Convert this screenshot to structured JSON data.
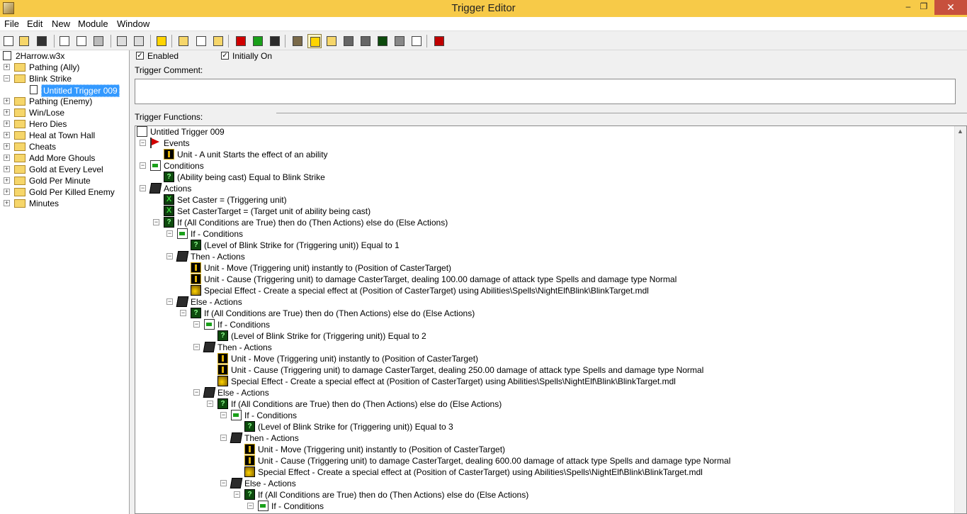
{
  "window": {
    "title": "Trigger Editor",
    "controls": {
      "minimize": "–",
      "restore": "❐",
      "close": "✕"
    }
  },
  "menu": [
    "File",
    "Edit",
    "New",
    "Module",
    "Window"
  ],
  "toolbar_icons": [
    "new-icon",
    "open-icon",
    "save-icon",
    "cut-icon",
    "copy-icon",
    "paste-icon",
    "undo-icon",
    "redo-icon",
    "delete-icon",
    "new-category-icon",
    "new-trigger-icon",
    "new-comment-icon",
    "new-event-icon",
    "new-condition-icon",
    "new-action-icon",
    "terrain-editor-icon",
    "trigger-editor-icon",
    "sound-editor-icon",
    "object-editor-icon",
    "campaign-editor-icon",
    "ai-editor-icon",
    "object-manager-icon",
    "import-manager-icon",
    "test-map-icon"
  ],
  "tree": {
    "root": "2Harrow.w3x",
    "categories": [
      {
        "label": "Pathing (Ally)",
        "expanded": false
      },
      {
        "label": "Blink Strike",
        "expanded": true,
        "children": [
          "Untitled Trigger 009"
        ]
      },
      {
        "label": "Pathing (Enemy)",
        "expanded": false
      },
      {
        "label": "Win/Lose",
        "expanded": false
      },
      {
        "label": "Hero Dies",
        "expanded": false
      },
      {
        "label": "Heal at Town Hall",
        "expanded": false
      },
      {
        "label": "Cheats",
        "expanded": false
      },
      {
        "label": "Add More Ghouls",
        "expanded": false
      },
      {
        "label": "Gold at Every Level",
        "expanded": false
      },
      {
        "label": "Gold Per Minute",
        "expanded": false
      },
      {
        "label": "Gold Per Killed Enemy",
        "expanded": false
      },
      {
        "label": "Minutes",
        "expanded": false
      }
    ],
    "selected": "Untitled Trigger 009"
  },
  "options": {
    "enabled_label": "Enabled",
    "enabled": true,
    "initially_on_label": "Initially On",
    "initially_on": true
  },
  "comment": {
    "label": "Trigger Comment:",
    "value": ""
  },
  "functions": {
    "label": "Trigger Functions:",
    "lines": [
      {
        "lvl": 0,
        "icon": "doc",
        "exp": "",
        "text": "Untitled Trigger 009"
      },
      {
        "lvl": 1,
        "icon": "evt",
        "exp": "−",
        "text": "Events"
      },
      {
        "lvl": 2,
        "icon": "unit",
        "exp": "",
        "text": "Unit - A unit Starts the effect of an ability"
      },
      {
        "lvl": 1,
        "icon": "cnd",
        "exp": "−",
        "text": "Conditions"
      },
      {
        "lvl": 2,
        "icon": "q",
        "exp": "",
        "text": "(Ability being cast) Equal to Blink Strike"
      },
      {
        "lvl": 1,
        "icon": "act",
        "exp": "−",
        "text": "Actions"
      },
      {
        "lvl": 2,
        "icon": "var",
        "exp": "",
        "text": "Set Caster = (Triggering unit)"
      },
      {
        "lvl": 2,
        "icon": "var",
        "exp": "",
        "text": "Set CasterTarget = (Target unit of ability being cast)"
      },
      {
        "lvl": 2,
        "icon": "q",
        "exp": "−",
        "text": "If (All Conditions are True) then do (Then Actions) else do (Else Actions)"
      },
      {
        "lvl": 3,
        "icon": "cnd",
        "exp": "−",
        "text": "If - Conditions"
      },
      {
        "lvl": 4,
        "icon": "q",
        "exp": "",
        "text": "(Level of Blink Strike  for (Triggering unit)) Equal to 1"
      },
      {
        "lvl": 3,
        "icon": "act",
        "exp": "−",
        "text": "Then - Actions"
      },
      {
        "lvl": 4,
        "icon": "unit",
        "exp": "",
        "text": "Unit - Move (Triggering unit) instantly to (Position of CasterTarget)"
      },
      {
        "lvl": 4,
        "icon": "unit",
        "exp": "",
        "text": "Unit - Cause (Triggering unit) to damage CasterTarget, dealing 100.00 damage of attack type Spells and damage type Normal"
      },
      {
        "lvl": 4,
        "icon": "fx",
        "exp": "",
        "text": "Special Effect - Create a special effect at (Position of CasterTarget) using Abilities\\Spells\\NightElf\\Blink\\BlinkTarget.mdl"
      },
      {
        "lvl": 3,
        "icon": "act",
        "exp": "−",
        "text": "Else - Actions"
      },
      {
        "lvl": 4,
        "icon": "q",
        "exp": "−",
        "text": "If (All Conditions are True) then do (Then Actions) else do (Else Actions)"
      },
      {
        "lvl": 5,
        "icon": "cnd",
        "exp": "−",
        "text": "If - Conditions"
      },
      {
        "lvl": 6,
        "icon": "q",
        "exp": "",
        "text": "(Level of Blink Strike  for (Triggering unit)) Equal to 2"
      },
      {
        "lvl": 5,
        "icon": "act",
        "exp": "−",
        "text": "Then - Actions"
      },
      {
        "lvl": 6,
        "icon": "unit",
        "exp": "",
        "text": "Unit - Move (Triggering unit) instantly to (Position of CasterTarget)"
      },
      {
        "lvl": 6,
        "icon": "unit",
        "exp": "",
        "text": "Unit - Cause (Triggering unit) to damage CasterTarget, dealing 250.00 damage of attack type Spells and damage type Normal"
      },
      {
        "lvl": 6,
        "icon": "fx",
        "exp": "",
        "text": "Special Effect - Create a special effect at (Position of CasterTarget) using Abilities\\Spells\\NightElf\\Blink\\BlinkTarget.mdl"
      },
      {
        "lvl": 5,
        "icon": "act",
        "exp": "−",
        "text": "Else - Actions"
      },
      {
        "lvl": 6,
        "icon": "q",
        "exp": "−",
        "text": "If (All Conditions are True) then do (Then Actions) else do (Else Actions)"
      },
      {
        "lvl": 7,
        "icon": "cnd",
        "exp": "−",
        "text": "If - Conditions"
      },
      {
        "lvl": 8,
        "icon": "q",
        "exp": "",
        "text": "(Level of Blink Strike  for (Triggering unit)) Equal to 3"
      },
      {
        "lvl": 7,
        "icon": "act",
        "exp": "−",
        "text": "Then - Actions"
      },
      {
        "lvl": 8,
        "icon": "unit",
        "exp": "",
        "text": "Unit - Move (Triggering unit) instantly to (Position of CasterTarget)"
      },
      {
        "lvl": 8,
        "icon": "unit",
        "exp": "",
        "text": "Unit - Cause (Triggering unit) to damage CasterTarget, dealing 600.00 damage of attack type Spells and damage type Normal"
      },
      {
        "lvl": 8,
        "icon": "fx",
        "exp": "",
        "text": "Special Effect - Create a special effect at (Position of CasterTarget) using Abilities\\Spells\\NightElf\\Blink\\BlinkTarget.mdl"
      },
      {
        "lvl": 7,
        "icon": "act",
        "exp": "−",
        "text": "Else - Actions"
      },
      {
        "lvl": 8,
        "icon": "q",
        "exp": "−",
        "text": "If (All Conditions are True) then do (Then Actions) else do (Else Actions)"
      },
      {
        "lvl": 9,
        "icon": "cnd",
        "exp": "−",
        "text": "If - Conditions"
      }
    ]
  },
  "colors": {
    "titlebar": "#f7ca48",
    "close": "#c7503d",
    "selection": "#3399ff"
  }
}
